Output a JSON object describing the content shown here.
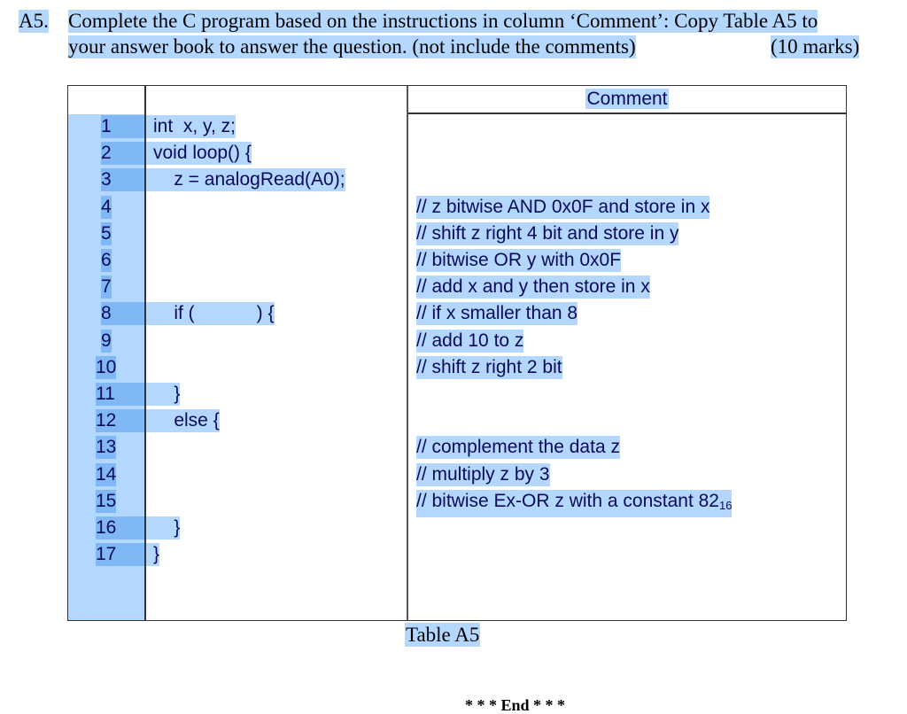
{
  "question": {
    "label": "A5.",
    "line1": "Complete the C program based on the instructions in column ‘Comment’: Copy Table A5 to",
    "line2": "your answer book to answer the question. (not include the comments)",
    "marks": "(10 marks)"
  },
  "table": {
    "comment_header": "Comment",
    "rows": [
      {
        "num": "1",
        "code": "int  x, y, z;",
        "comment": ""
      },
      {
        "num": "2",
        "code": "void loop() {",
        "comment": ""
      },
      {
        "num": "3",
        "code": "    z = analogRead(A0);",
        "comment": ""
      },
      {
        "num": "4",
        "code": "",
        "comment": "// z bitwise AND 0x0F and store in x"
      },
      {
        "num": "5",
        "code": "",
        "comment": "// shift z right 4 bit and store in y"
      },
      {
        "num": "6",
        "code": "",
        "comment": "// bitwise OR y with 0x0F"
      },
      {
        "num": "7",
        "code": "",
        "comment": "// add x and y then store in x"
      },
      {
        "num": "8",
        "code": "    if (            ) {",
        "comment": "// if x smaller than 8"
      },
      {
        "num": "9",
        "code": "",
        "comment": "// add 10 to z"
      },
      {
        "num": "10",
        "code": "",
        "comment": "// shift z right 2 bit"
      },
      {
        "num": "11",
        "code": "    }",
        "comment": ""
      },
      {
        "num": "12",
        "code": "    else {",
        "comment": ""
      },
      {
        "num": "13",
        "code": "",
        "comment": "// complement the data z"
      },
      {
        "num": "14",
        "code": "",
        "comment": "// multiply z by 3"
      },
      {
        "num": "15",
        "code": "",
        "comment": "// bitwise Ex-OR z with a constant 82",
        "comment_subscript": "16"
      },
      {
        "num": "16",
        "code": "    }",
        "comment": ""
      },
      {
        "num": "17",
        "code": "}",
        "comment": ""
      }
    ],
    "caption": "Table A5"
  },
  "footer": {
    "end_marker": "* * * End * * *"
  }
}
